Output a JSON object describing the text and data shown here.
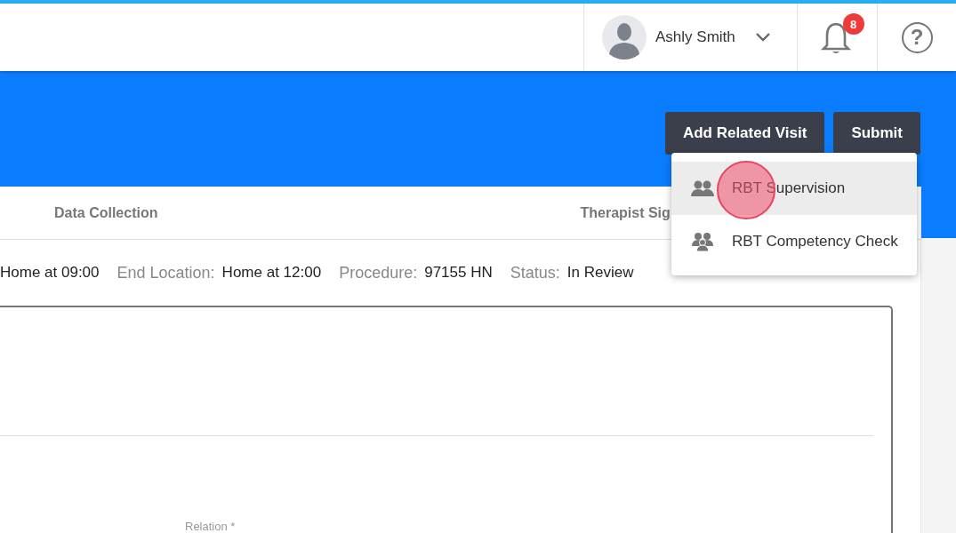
{
  "header": {
    "user_name": "Ashly Smith",
    "notification_count": "8",
    "help_icon": "?"
  },
  "actions": {
    "buttons": [
      "Add Related Visit",
      "Submit"
    ],
    "menu": [
      {
        "label": "RBT Supervision",
        "selected": true,
        "kind": "pair"
      },
      {
        "label": "RBT Competency Check",
        "selected": false,
        "kind": "group"
      }
    ]
  },
  "tabs": [
    {
      "label": "Data Collection",
      "selected": false
    },
    {
      "label": "Therapist Sig",
      "selected": false
    }
  ],
  "visit_info": [
    {
      "value": "Home at 09:00"
    },
    {
      "label": "End Location:",
      "value": "Home at 12:00"
    },
    {
      "label": "Procedure:",
      "value": "97155 HN"
    },
    {
      "label": "Status:",
      "value": "In Review"
    }
  ],
  "form": {
    "field_label": "Relation *"
  }
}
